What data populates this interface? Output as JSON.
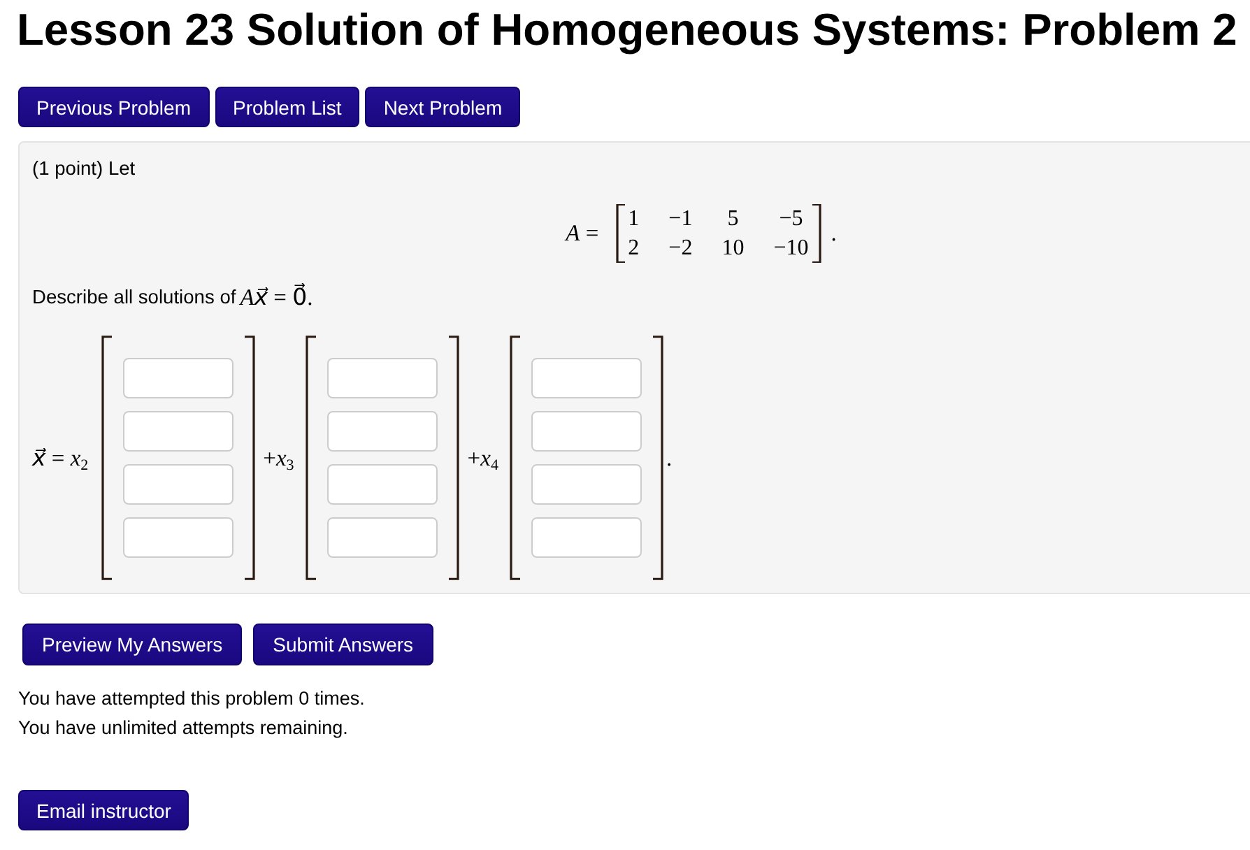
{
  "title": "Lesson 23 Solution of Homogeneous Systems: Problem 2",
  "nav_buttons": [
    "Previous Problem",
    "Problem List",
    "Next Problem"
  ],
  "problem": {
    "intro": "(1 point) Let",
    "matrix": {
      "label": "*A* =",
      "rows": [
        [
          "1",
          "−1",
          "5",
          "−5"
        ],
        [
          "2",
          "−2",
          "10",
          "−10"
        ]
      ],
      "end": "."
    },
    "prompt": "Describe all solutions of",
    "equation": "*Ax⃗* = 0⃗.",
    "solution": {
      "terms": [
        {
          "label": "*x⃗* = *x*$_{2}$",
          "entries": [
            {
              "kind": "blank"
            },
            {
              "kind": "blank"
            },
            {
              "kind": "blank"
            },
            {
              "kind": "blank"
            }
          ]
        },
        {
          "label": "+*x*$_{3}$",
          "entries": [
            {
              "kind": "blank"
            },
            {
              "kind": "blank"
            },
            {
              "kind": "blank"
            },
            {
              "kind": "blank"
            }
          ]
        },
        {
          "label": "+*x*$_{4}$",
          "entries": [
            {
              "kind": "blank"
            },
            {
              "kind": "blank"
            },
            {
              "kind": "blank"
            },
            {
              "kind": "blank"
            }
          ]
        }
      ],
      "end": "."
    }
  },
  "answer_buttons": [
    "Preview My Answers",
    "Submit Answers"
  ],
  "attempts": [
    "You have attempted this problem 0 times.",
    "You have unlimited attempts remaining."
  ],
  "email_button": "Email instructor"
}
